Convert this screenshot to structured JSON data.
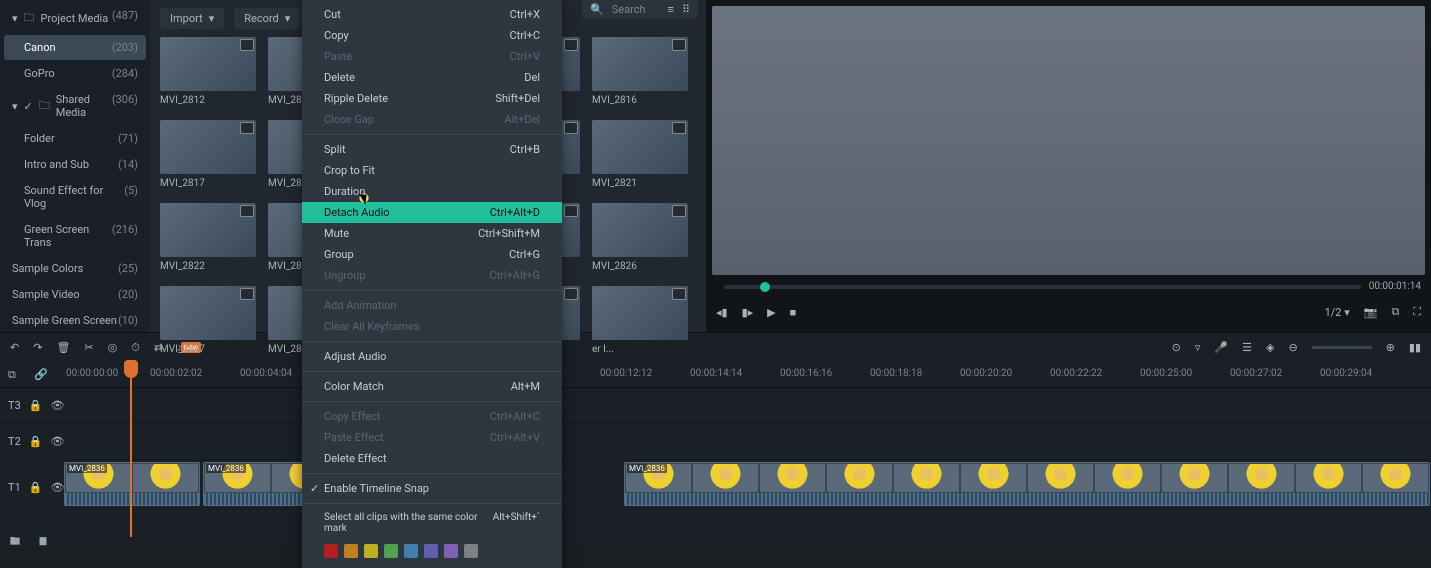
{
  "sidebar": {
    "items": [
      {
        "icon": "folder",
        "name": "Project Media",
        "count": "(487)",
        "expanded": true,
        "indent": 0
      },
      {
        "icon": "",
        "name": "Canon",
        "count": "(203)",
        "selected": true,
        "indent": 1
      },
      {
        "icon": "",
        "name": "GoPro",
        "count": "(284)",
        "indent": 1
      },
      {
        "icon": "folder",
        "name": "Shared Media",
        "count": "(306)",
        "expanded": true,
        "indent": 0,
        "checked": true
      },
      {
        "icon": "",
        "name": "Folder",
        "count": "(71)",
        "indent": 1
      },
      {
        "icon": "",
        "name": "Intro and Sub",
        "count": "(14)",
        "indent": 1
      },
      {
        "icon": "",
        "name": "Sound Effect for Vlog",
        "count": "(5)",
        "indent": 1
      },
      {
        "icon": "",
        "name": "Green Screen Trans",
        "count": "(216)",
        "indent": 1
      },
      {
        "icon": "",
        "name": "Sample Colors",
        "count": "(25)",
        "indent": 0
      },
      {
        "icon": "",
        "name": "Sample Video",
        "count": "(20)",
        "indent": 0
      },
      {
        "icon": "",
        "name": "Sample Green Screen",
        "count": "(10)",
        "indent": 0
      }
    ]
  },
  "media_panel": {
    "import_label": "Import",
    "record_label": "Record",
    "search_placeholder": "Search",
    "thumbs": [
      {
        "label": "MVI_2812"
      },
      {
        "label": "MVI_28"
      },
      {
        "label": ""
      },
      {
        "label": ""
      },
      {
        "label": "MVI_2816"
      },
      {
        "label": "MVI_2817"
      },
      {
        "label": "MVI_28"
      },
      {
        "label": ""
      },
      {
        "label": ""
      },
      {
        "label": "MVI_2821"
      },
      {
        "label": "MVI_2822"
      },
      {
        "label": "MVI_28"
      },
      {
        "label": ""
      },
      {
        "label": ""
      },
      {
        "label": "MVI_2826"
      },
      {
        "label": "MVI_2827"
      },
      {
        "label": "MVI_28"
      },
      {
        "label": ""
      },
      {
        "label": ""
      },
      {
        "label": "er I..."
      }
    ]
  },
  "context_menu": {
    "items": [
      {
        "label": "Cut",
        "shortcut": "Ctrl+X"
      },
      {
        "label": "Copy",
        "shortcut": "Ctrl+C"
      },
      {
        "label": "Paste",
        "shortcut": "Ctrl+V",
        "disabled": true
      },
      {
        "label": "Delete",
        "shortcut": "Del"
      },
      {
        "label": "Ripple Delete",
        "shortcut": "Shift+Del"
      },
      {
        "label": "Close Gap",
        "shortcut": "Alt+Del",
        "disabled": true
      },
      {
        "sep": true
      },
      {
        "label": "Split",
        "shortcut": "Ctrl+B"
      },
      {
        "label": "Crop to Fit",
        "shortcut": ""
      },
      {
        "label": "Duration",
        "shortcut": ""
      },
      {
        "label": "Detach Audio",
        "shortcut": "Ctrl+Alt+D",
        "highlight": true
      },
      {
        "label": "Mute",
        "shortcut": "Ctrl+Shift+M"
      },
      {
        "label": "Group",
        "shortcut": "Ctrl+G"
      },
      {
        "label": "Ungroup",
        "shortcut": "Ctrl+Alt+G",
        "disabled": true
      },
      {
        "sep": true
      },
      {
        "label": "Add Animation",
        "shortcut": "",
        "disabled": true
      },
      {
        "label": "Clear All Keyframes",
        "shortcut": "",
        "disabled": true
      },
      {
        "sep": true
      },
      {
        "label": "Adjust Audio",
        "shortcut": ""
      },
      {
        "sep": true
      },
      {
        "label": "Color Match",
        "shortcut": "Alt+M"
      },
      {
        "sep": true
      },
      {
        "label": "Copy Effect",
        "shortcut": "Ctrl+Alt+C",
        "disabled": true
      },
      {
        "label": "Paste Effect",
        "shortcut": "Ctrl+Alt+V",
        "disabled": true
      },
      {
        "label": "Delete Effect",
        "shortcut": ""
      },
      {
        "sep": true
      },
      {
        "label": "Enable Timeline Snap",
        "shortcut": "",
        "checked": true
      },
      {
        "sep": true
      },
      {
        "label": "Select all clips with the same color mark",
        "shortcut": "Alt+Shift+`",
        "small": true
      }
    ],
    "swatches": [
      "#b02020",
      "#c08020",
      "#c0b020",
      "#50a050",
      "#4080b0",
      "#6060b0",
      "#8060b0",
      "#808080"
    ]
  },
  "preview": {
    "timecode": "00:00:01:14",
    "ratio": "1/2"
  },
  "timeline": {
    "start": "00:00:00:00",
    "marks": [
      "00:00:02:02",
      "00:00:04:04",
      "",
      "",
      "",
      "00:00:12:12",
      "00:00:14:14",
      "00:00:16:16",
      "00:00:18:18",
      "00:00:20:20",
      "00:00:22:22",
      "00:00:25:00",
      "00:00:27:02",
      "00:00:29:04"
    ],
    "clip_label": "MVI_2836",
    "tracks": [
      "T3",
      "T2",
      "T1"
    ]
  },
  "toolbar": {
    "new_badge": "new"
  }
}
